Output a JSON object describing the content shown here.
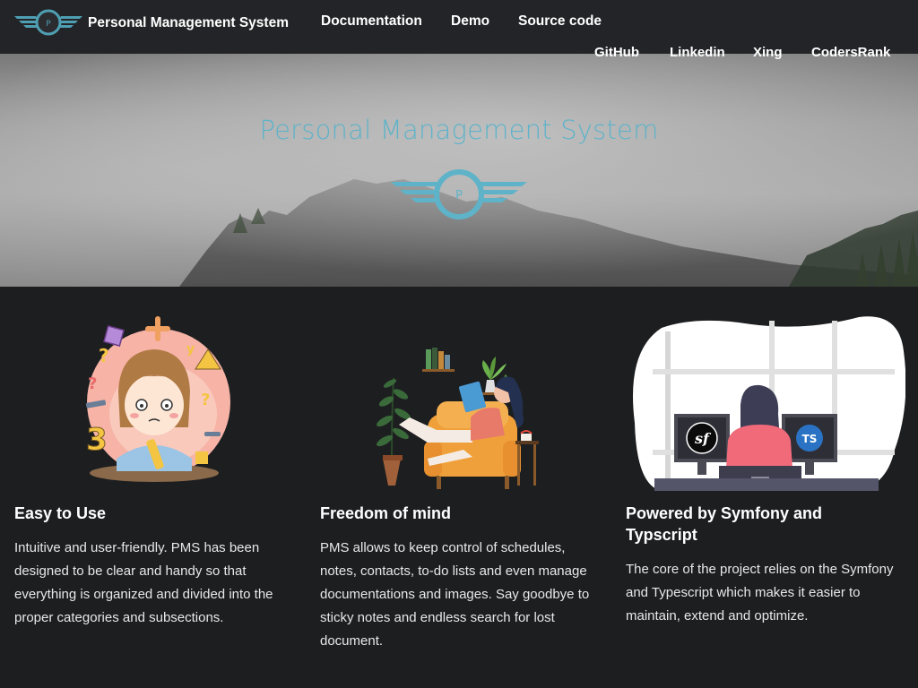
{
  "brand": {
    "name": "Personal Management System",
    "logo_icon": "pms-winged-logo-icon",
    "logo_letter": "P"
  },
  "nav": {
    "main": [
      {
        "label": "Documentation"
      },
      {
        "label": "Demo"
      },
      {
        "label": "Source code"
      }
    ],
    "sub": [
      {
        "label": "GitHub"
      },
      {
        "label": "Linkedin"
      },
      {
        "label": "Xing"
      },
      {
        "label": "CodersRank"
      }
    ]
  },
  "hero": {
    "title": "Personal Management System",
    "logo_letter": "P"
  },
  "features": [
    {
      "title": "Easy to Use",
      "text": "Intuitive and user-friendly. PMS has been designed to be clear and handy so that everything is organized and divided into the proper categories and subsections.",
      "illustration": "confused-girl-illustration"
    },
    {
      "title": "Freedom of mind",
      "text": "PMS allows to keep control of schedules, notes, contacts, to-do lists and even manage documentations and images. Say goodbye to sticky notes and endless search for lost document.",
      "illustration": "woman-reading-in-armchair-illustration"
    },
    {
      "title": "Powered by Symfony and Typscript",
      "text": "The core of the project relies on the Symfony and Typescript which makes it easier to maintain, extend and optimize.",
      "illustration": "developer-at-monitors-illustration",
      "badge_left": "sf",
      "badge_right": "TS"
    }
  ],
  "colors": {
    "navbar": "#232427",
    "page": "#1d1e20",
    "accent": "#5eb3c9"
  }
}
